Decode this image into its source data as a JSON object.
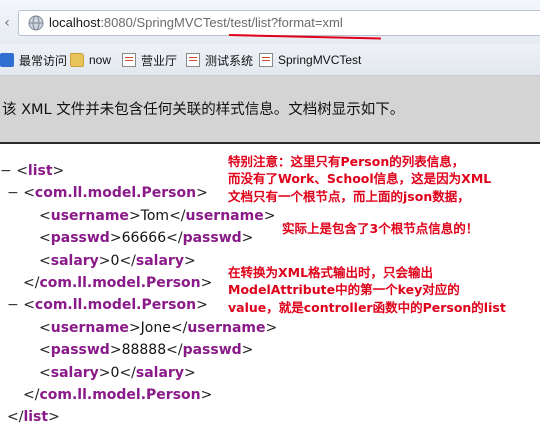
{
  "browser": {
    "url_host": "localhost",
    "url_path": ":8080/SpringMVCTest/test/list?format=xml",
    "bookmarks": [
      {
        "label": "最常访问",
        "icon": "star-icon"
      },
      {
        "label": "now",
        "icon": "folder-icon"
      },
      {
        "label": "营业厅",
        "icon": "page-icon"
      },
      {
        "label": "测试系统",
        "icon": "page-icon"
      },
      {
        "label": "SpringMVCTest",
        "icon": "page-icon"
      }
    ]
  },
  "info_message": "该 XML 文件并未包含任何关联的样式信息。文档树显示如下。",
  "xml": {
    "toggle_open": "−",
    "root_tag": "list",
    "item_tag": "com.ll.model.Person",
    "persons": [
      {
        "username": "Tom",
        "passwd": "66666",
        "salary": "0"
      },
      {
        "username": "Jone",
        "passwd": "88888",
        "salary": "0"
      }
    ],
    "field_names": {
      "username": "username",
      "passwd": "passwd",
      "salary": "salary"
    }
  },
  "annotations": {
    "note1": [
      "特别注意：这里只有Person的列表信息，",
      "而没有了Work、School信息，这是因为XML",
      "文档只有一个根节点，而上面的json数据，"
    ],
    "note2": "实际上是包含了3个根节点信息的！",
    "note3": [
      "在转换为XML格式输出时，只会输出",
      "ModelAttribute中的第一个key对应的",
      "value，就是controller函数中的Person的list"
    ]
  },
  "colors": {
    "annotation": "#e0001a",
    "xml_tag": "#8a1a8a",
    "info_band": "#d4d4d4"
  }
}
